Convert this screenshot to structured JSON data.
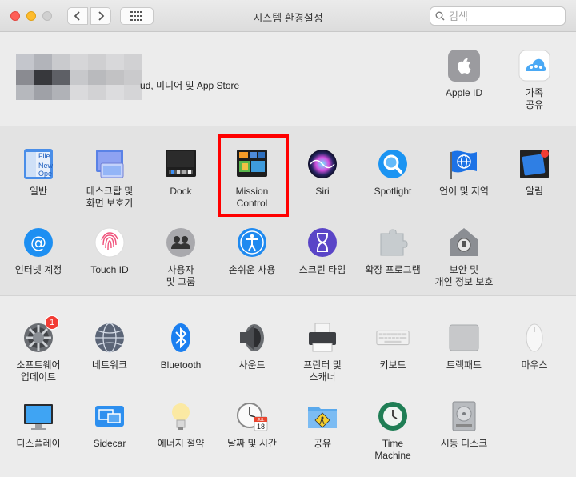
{
  "window": {
    "title": "시스템 환경설정"
  },
  "toolbar": {
    "back": "‹",
    "forward": "›"
  },
  "search": {
    "placeholder": "검색",
    "value": ""
  },
  "account": {
    "description": "ud, 미디어 및 App Store",
    "apple_id": "Apple ID",
    "family_sharing": "가족\n공유"
  },
  "section1": [
    {
      "label": "일반",
      "icon": "general-icon"
    },
    {
      "label": "데스크탑 및\n화면 보호기",
      "icon": "desktop-screensaver-icon"
    },
    {
      "label": "Dock",
      "icon": "dock-icon"
    },
    {
      "label": "Mission\nControl",
      "icon": "mission-control-icon"
    },
    {
      "label": "Siri",
      "icon": "siri-icon"
    },
    {
      "label": "Spotlight",
      "icon": "spotlight-icon"
    },
    {
      "label": "언어 및 지역",
      "icon": "language-region-icon"
    },
    {
      "label": "알림",
      "icon": "notifications-icon"
    },
    {
      "label": "인터넷 계정",
      "icon": "internet-accounts-icon"
    },
    {
      "label": "Touch ID",
      "icon": "touch-id-icon"
    },
    {
      "label": "사용자\n및 그룹",
      "icon": "users-groups-icon"
    },
    {
      "label": "손쉬운 사용",
      "icon": "accessibility-icon"
    },
    {
      "label": "스크린 타임",
      "icon": "screen-time-icon"
    },
    {
      "label": "확장 프로그램",
      "icon": "extensions-icon"
    },
    {
      "label": "보안 및\n개인 정보 보호",
      "icon": "security-privacy-icon"
    }
  ],
  "section2": [
    {
      "label": "소프트웨어\n업데이트",
      "icon": "software-update-icon",
      "badge": "1"
    },
    {
      "label": "네트워크",
      "icon": "network-icon"
    },
    {
      "label": "Bluetooth",
      "icon": "bluetooth-icon"
    },
    {
      "label": "사운드",
      "icon": "sound-icon"
    },
    {
      "label": "프린터 및\n스캐너",
      "icon": "printers-scanners-icon"
    },
    {
      "label": "키보드",
      "icon": "keyboard-icon"
    },
    {
      "label": "트랙패드",
      "icon": "trackpad-icon"
    },
    {
      "label": "마우스",
      "icon": "mouse-icon"
    },
    {
      "label": "디스플레이",
      "icon": "displays-icon"
    },
    {
      "label": "Sidecar",
      "icon": "sidecar-icon"
    },
    {
      "label": "에너지 절약",
      "icon": "energy-saver-icon"
    },
    {
      "label": "날짜 및 시간",
      "icon": "date-time-icon"
    },
    {
      "label": "공유",
      "icon": "sharing-icon"
    },
    {
      "label": "Time\nMachine",
      "icon": "time-machine-icon"
    },
    {
      "label": "시동 디스크",
      "icon": "startup-disk-icon"
    }
  ],
  "calendar_icon": {
    "month": "JUL",
    "day": "18"
  },
  "colors": {
    "highlight": "#ff0000",
    "accent": "#1a82fb"
  }
}
